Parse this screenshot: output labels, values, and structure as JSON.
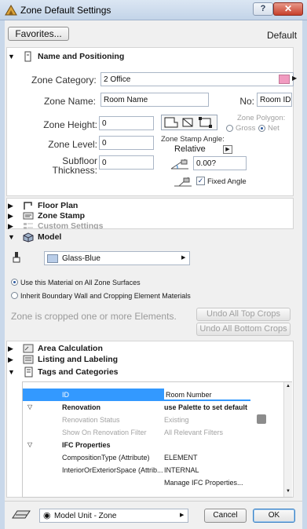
{
  "window": {
    "title": "Zone Default Settings"
  },
  "toolbar": {
    "favorites_label": "Favorites...",
    "default_label": "Default"
  },
  "sections": {
    "name_positioning": "Name and Positioning",
    "floor_plan": "Floor Plan",
    "zone_stamp": "Zone Stamp",
    "custom_settings": "Custom Settings",
    "model": "Model",
    "area_calculation": "Area Calculation",
    "listing_labeling": "Listing and Labeling",
    "tags_categories": "Tags and Categories"
  },
  "name_positioning": {
    "category_label": "Zone Category:",
    "category_value": "2  Office",
    "category_color": "#f19bc0",
    "name_label": "Zone Name:",
    "name_value": "Room Name",
    "no_label": "No:",
    "no_value": "Room ID",
    "height_label": "Zone Height:",
    "height_value": "0",
    "level_label": "Zone Level:",
    "level_value": "0",
    "subfloor_label_1": "Subfloor",
    "subfloor_label_2": "Thickness:",
    "subfloor_value": "0",
    "polygon_label": "Zone Polygon:",
    "gross_label": "Gross",
    "net_label": "Net",
    "stamp_angle_label": "Zone Stamp Angle:",
    "stamp_angle_mode": "Relative",
    "angle_value": "0.00?",
    "fixed_angle_label": "Fixed Angle"
  },
  "model": {
    "material_value": "Glass-Blue",
    "material_color": "#b9cde8",
    "option_all_surfaces": "Use this Material on All Zone Surfaces",
    "option_inherit": "Inherit Boundary Wall and Cropping Element Materials",
    "cropped_text": "Zone is cropped one or more Elements.",
    "undo_top_label": "Undo All Top Crops",
    "undo_bottom_label": "Undo All Bottom Crops"
  },
  "tags": {
    "rows": [
      {
        "name": "ID",
        "value": "Room Number"
      },
      {
        "name": "Renovation",
        "value": "use Palette to set default"
      },
      {
        "name": "Renovation Status",
        "value": "Existing"
      },
      {
        "name": "Show On Renovation Filter",
        "value": "All Relevant Filters"
      },
      {
        "name": "IFC Properties",
        "value": ""
      },
      {
        "name": "CompositionType (Attribute)",
        "value": "ELEMENT"
      },
      {
        "name": "InteriorOrExteriorSpace (Attrib...",
        "value": "INTERNAL"
      },
      {
        "name": "",
        "value": "Manage IFC Properties..."
      }
    ],
    "selected_color": "#3399ff"
  },
  "footer": {
    "model_unit_label": "Model Unit - Zone",
    "cancel_label": "Cancel",
    "ok_label": "OK"
  }
}
